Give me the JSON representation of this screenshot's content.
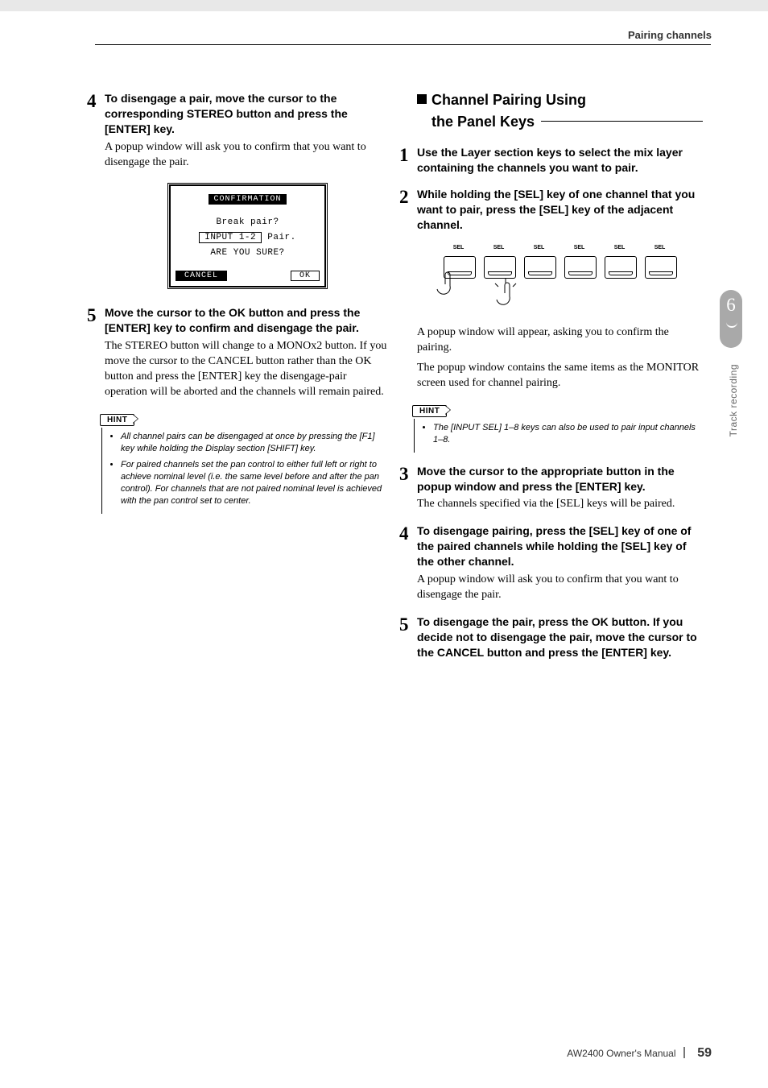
{
  "header": {
    "section": "Pairing channels"
  },
  "tab": {
    "chapter_number": "6",
    "chapter_title": "Track recording"
  },
  "footer": {
    "product": "AW2400  Owner's Manual",
    "page": "59"
  },
  "left": {
    "step4": {
      "num": "4",
      "bold": "To disengage a pair, move the cursor to the corresponding STEREO button and press the [ENTER] key.",
      "body": "A popup window will ask you to confirm that you want to disengage the pair."
    },
    "popup": {
      "title": "CONFIRMATION",
      "line1": "Break pair?",
      "input": "INPUT 1-2",
      "pair_suffix": "Pair.",
      "ask": "ARE YOU SURE?",
      "btn_cancel": "CANCEL",
      "btn_ok": "OK"
    },
    "step5": {
      "num": "5",
      "bold": "Move the cursor to the OK button and press the [ENTER] key to confirm and disengage the pair.",
      "body": "The STEREO button will change to a MONOx2 button. If you move the cursor to the CANCEL button rather than the OK button and press the [ENTER] key the disengage-pair operation will be aborted and the channels will remain paired."
    },
    "hint": {
      "label": "HINT",
      "items": [
        "All channel pairs can be disengaged at once by pressing the [F1] key while holding the Display section [SHIFT] key.",
        "For paired channels set the pan control to either full left or right to achieve nominal level (i.e. the same level before and after the pan control). For channels that are not paired nominal level is achieved with the pan control set to center."
      ]
    }
  },
  "right": {
    "heading_l1": "Channel Pairing Using",
    "heading_l2": "the Panel Keys",
    "step1": {
      "num": "1",
      "bold": "Use the Layer section keys to select the mix layer containing the channels you want to pair."
    },
    "step2": {
      "num": "2",
      "bold": "While holding the [SEL] key of one channel that you want to pair, press the [SEL] key of the adjacent channel.",
      "body1": "A popup window will appear, asking you to confirm the pairing.",
      "body2": "The popup window contains the same items as the MONITOR screen used for channel pairing."
    },
    "sel_label": "SEL",
    "hint": {
      "label": "HINT",
      "item": "The [INPUT SEL] 1–8 keys can also be used to pair input channels 1–8."
    },
    "step3": {
      "num": "3",
      "bold": "Move the cursor to the appropriate button in the popup window and press the [ENTER] key.",
      "body": "The channels specified via the [SEL] keys will be paired."
    },
    "step4": {
      "num": "4",
      "bold": "To disengage pairing, press the [SEL] key of one of the paired channels while holding the [SEL] key of the other channel.",
      "body": "A popup window will ask you to confirm that you want to disengage the pair."
    },
    "step5": {
      "num": "5",
      "bold": "To disengage the pair, press the OK button. If you decide not to disengage the pair, move the cursor to the CANCEL button and press the [ENTER] key."
    }
  }
}
